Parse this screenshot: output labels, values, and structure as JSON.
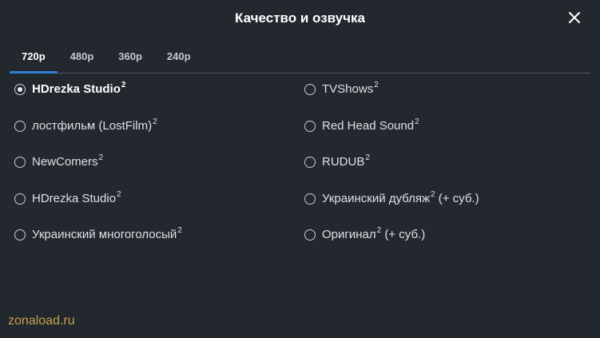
{
  "dialog": {
    "title": "Качество и озвучка",
    "close_icon": "close-icon"
  },
  "tabs": [
    {
      "label": "720p",
      "active": true
    },
    {
      "label": "480p",
      "active": false
    },
    {
      "label": "360p",
      "active": false
    },
    {
      "label": "240p",
      "active": false
    }
  ],
  "options": {
    "left": [
      {
        "label": "HDrezka Studio",
        "sup": "2",
        "suffix": "",
        "selected": true
      },
      {
        "label": "лостфильм (LostFilm)",
        "sup": "2",
        "suffix": "",
        "selected": false
      },
      {
        "label": "NewComers",
        "sup": "2",
        "suffix": "",
        "selected": false
      },
      {
        "label": "HDrezka Studio",
        "sup": "2",
        "suffix": "",
        "selected": false
      },
      {
        "label": "Украинский многоголосый",
        "sup": "2",
        "suffix": "",
        "selected": false
      }
    ],
    "right": [
      {
        "label": "TVShows",
        "sup": "2",
        "suffix": "",
        "selected": false
      },
      {
        "label": "Red Head Sound",
        "sup": "2",
        "suffix": "",
        "selected": false
      },
      {
        "label": "RUDUB",
        "sup": "2",
        "suffix": "",
        "selected": false
      },
      {
        "label": "Украинский дубляж",
        "sup": "2",
        "suffix": " (+ суб.)",
        "selected": false
      },
      {
        "label": "Оригинал",
        "sup": "2",
        "suffix": " (+ суб.)",
        "selected": false
      }
    ]
  },
  "watermark": "zonaload.ru",
  "colors": {
    "background": "#23282f",
    "accent": "#2f80d1",
    "watermark": "#c6a14a"
  }
}
